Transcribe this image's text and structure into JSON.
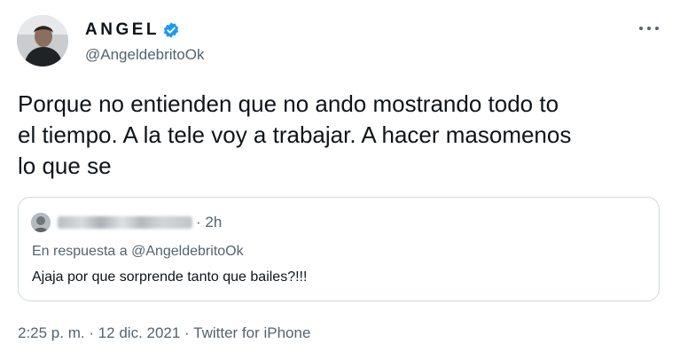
{
  "author": {
    "display_name": "ANGEL",
    "handle": "@AngeldebritoOk",
    "verified": true,
    "verified_color": "#1d9bf0"
  },
  "tweet": {
    "text": "Porque no entienden que no ando mostrando todo to\nel tiempo. A la tele voy a trabajar. A hacer masomenos\nlo que se"
  },
  "quoted_tweet": {
    "time": "· 2h",
    "reply_to": "En respuesta a @AngeldebritoOk",
    "text": "Ajaja por que sorprende tanto que bailes?!!!"
  },
  "meta": {
    "timestamp": "2:25 p. m. · 12 dic. 2021 · ",
    "source": "Twitter for iPhone"
  },
  "icons": {
    "more": "more-horizontal-icon",
    "verified": "verified-badge-icon"
  },
  "colors": {
    "text_primary": "#0f1419",
    "text_secondary": "#536471",
    "border": "#cfd9de"
  }
}
